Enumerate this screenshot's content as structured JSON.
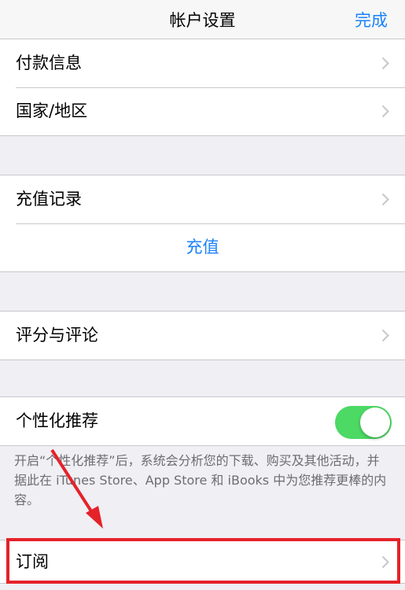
{
  "nav": {
    "title": "帐户设置",
    "done_label": "完成"
  },
  "group1": {
    "items": [
      {
        "label": "付款信息"
      },
      {
        "label": "国家/地区"
      }
    ]
  },
  "group2": {
    "history_label": "充值记录",
    "recharge_label": "充值"
  },
  "group3": {
    "items": [
      {
        "label": "评分与评论"
      }
    ]
  },
  "group4": {
    "personalized_label": "个性化推荐",
    "toggle_on": true,
    "footer_note": "开启“个性化推荐”后，系统会分析您的下载、购买及其他活动，并据此在 iTunes Store、App Store 和 iBooks 中为您推荐更棒的内容。"
  },
  "group5": {
    "subscriptions_label": "订阅"
  },
  "colors": {
    "accent": "#1a82fb",
    "toggle_on": "#4cd964",
    "highlight": "#e52229",
    "background": "#efeff4"
  }
}
